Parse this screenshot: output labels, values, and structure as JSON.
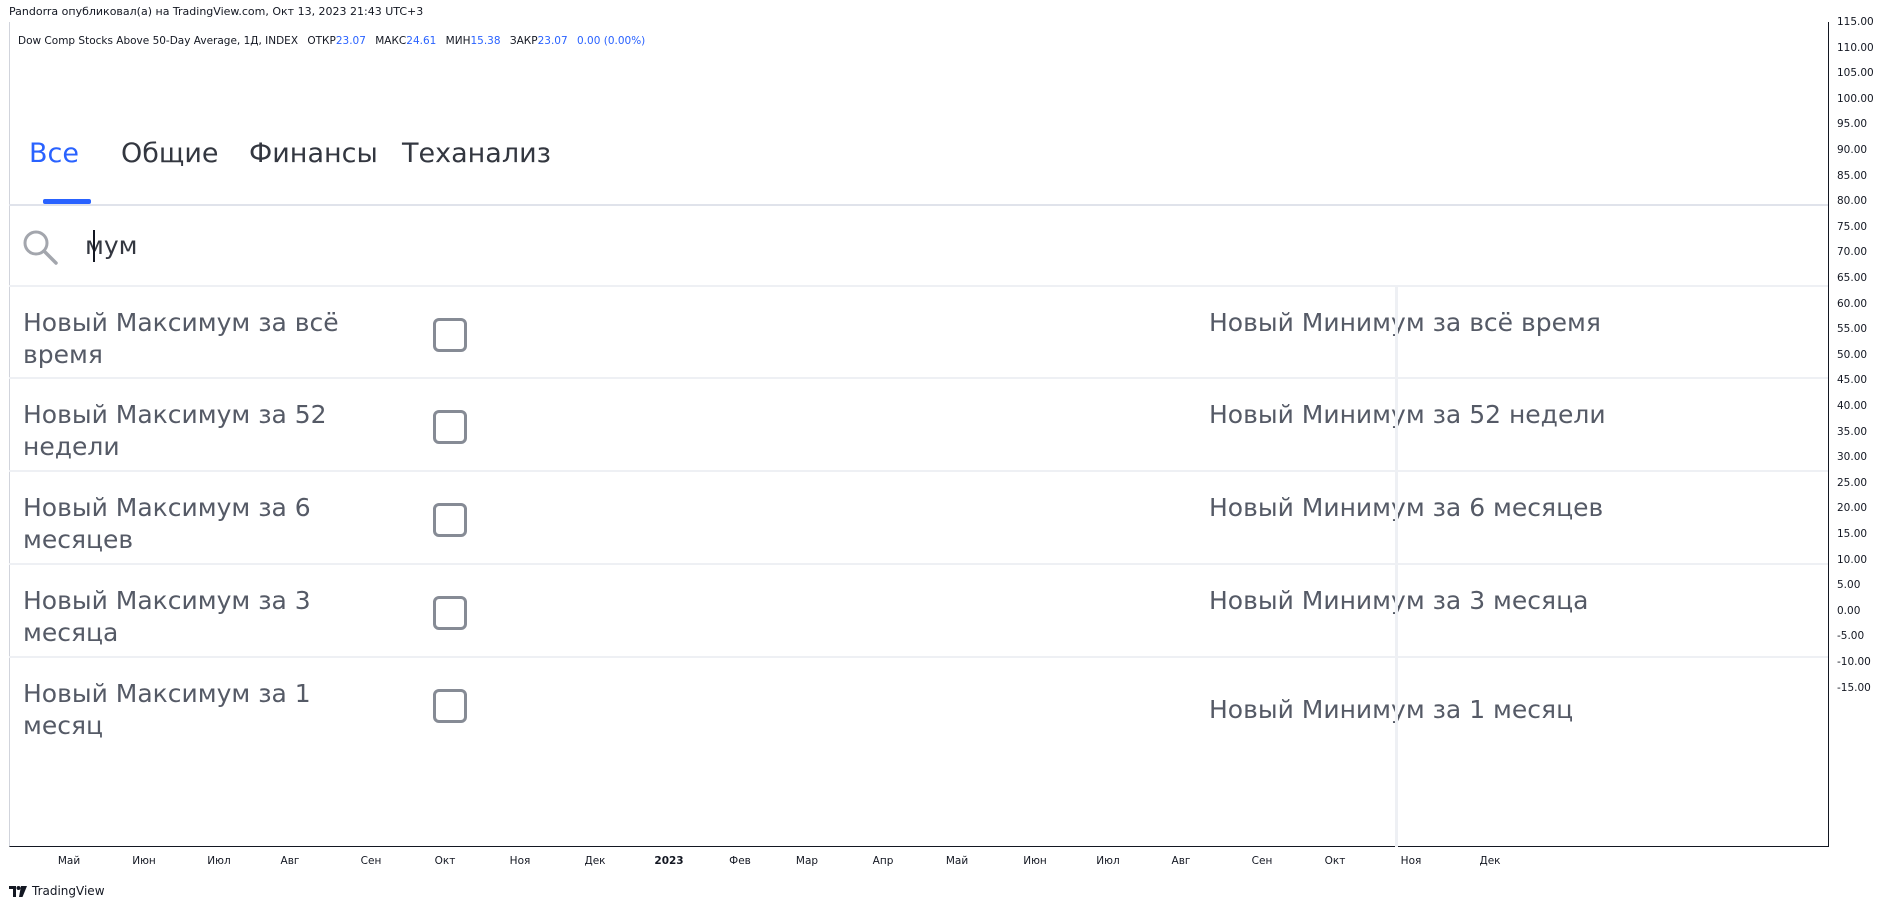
{
  "header": {
    "published": "Pandorra опубликовал(а) на TradingView.com, Окт 13, 2023 21:43 UTC+3"
  },
  "legend": {
    "symbol": "Dow Comp Stocks Above 50-Day Average, 1Д, INDEX",
    "open_label": "ОТКР",
    "open_value": "23.07",
    "high_label": "МАКС",
    "high_value": "24.61",
    "low_label": "МИН",
    "low_value": "15.38",
    "close_label": "ЗАКР",
    "close_value": "23.07",
    "change": "0.00 (0.00%)"
  },
  "tabs": [
    {
      "label": "Все",
      "active": true
    },
    {
      "label": "Общие",
      "active": false
    },
    {
      "label": "Финансы",
      "active": false
    },
    {
      "label": "Теханализ",
      "active": false
    }
  ],
  "search": {
    "value": "мум",
    "icon": "search-icon"
  },
  "items": [
    {
      "left": "Новый Максимум за всё время",
      "right": "Новый Минимум за всё время",
      "checked": false
    },
    {
      "left": "Новый Максимум за 52 недели",
      "right": "Новый Минимум за 52 недели",
      "checked": false
    },
    {
      "left": "Новый Максимум за 6 месяцев",
      "right": "Новый Минимум за 6 месяцев",
      "checked": false
    },
    {
      "left": "Новый Максимум за 3 месяца",
      "right": "Новый Минимум за 3 месяца",
      "checked": false
    },
    {
      "left": "Новый Максимум за 1 месяц",
      "right": "Новый Минимум за 1 месяц",
      "checked": false
    }
  ],
  "price_axis": [
    "115.00",
    "110.00",
    "105.00",
    "100.00",
    "95.00",
    "90.00",
    "85.00",
    "80.00",
    "75.00",
    "70.00",
    "65.00",
    "60.00",
    "55.00",
    "50.00",
    "45.00",
    "40.00",
    "35.00",
    "30.00",
    "25.00",
    "20.00",
    "15.00",
    "10.00",
    "5.00",
    "0.00",
    "-5.00",
    "-10.00",
    "-15.00"
  ],
  "time_axis": [
    "Май",
    "Июн",
    "Июл",
    "Авг",
    "Сен",
    "Окт",
    "Ноя",
    "Дек",
    "2023",
    "Фев",
    "Мар",
    "Апр",
    "Май",
    "Июн",
    "Июл",
    "Авг",
    "Сен",
    "Окт",
    "Ноя",
    "Дек"
  ],
  "footer": {
    "brand": "TradingView"
  },
  "colors": {
    "accent": "#2962ff",
    "text": "#131722",
    "muted": "#555a66",
    "divider": "#eef0f4"
  }
}
